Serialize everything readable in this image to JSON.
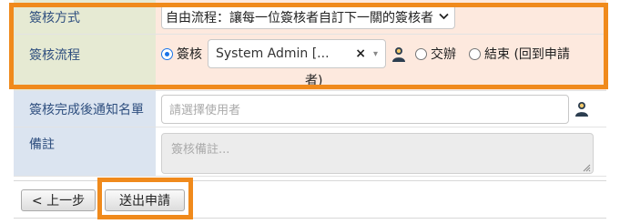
{
  "form": {
    "rows": {
      "method": {
        "label": "簽核方式",
        "value": "自由流程：讓每一位簽核者自訂下一關的簽核者"
      },
      "flow": {
        "label": "簽核流程",
        "option_sign": "簽核",
        "user_value": "System Admin [...",
        "clear_symbol": "×",
        "caret_symbol": "▾",
        "option_handle": "交辦",
        "option_end": "結束 (回到申請",
        "option_end_wrap": "者)"
      },
      "notify": {
        "label": "簽核完成後通知名單",
        "placeholder": "請選擇使用者"
      },
      "remark": {
        "label": "備註",
        "placeholder": "簽核備註..."
      }
    }
  },
  "buttons": {
    "prev": "< 上一步",
    "submit": "送出申請"
  },
  "colors": {
    "highlight": "#f08a1c",
    "label_bg": "#dbe4f0",
    "label_text": "#2f4f7f",
    "person_icon": "#2c3e50",
    "radio_selected": "#1a73e8"
  },
  "icons": {
    "select_chevron": "chevron-down-icon",
    "user_picker": "person-icon",
    "resize": "resize-grip-icon"
  }
}
